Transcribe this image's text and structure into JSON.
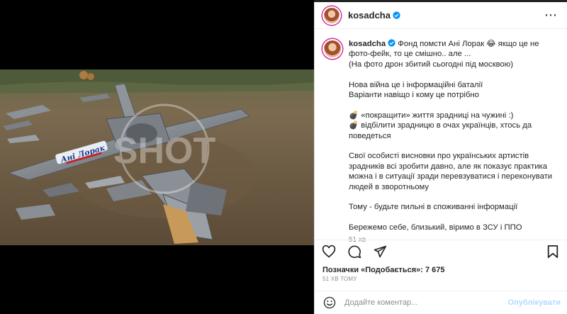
{
  "post": {
    "username": "kosadcha",
    "caption_lines": [
      "Фонд помсти Ані Лорак 😂 якщо це не фото-фейк, то це смішно.. але ...",
      "(На фото дрон збитий сьогодні під москвою)"
    ],
    "paragraph2": [
      "Нова війна це і інформаційні баталії",
      "Варіанти навіщо і кому це потрібно"
    ],
    "paragraph3": [
      "💣 «покращити» життя зрадниці на чужині :)",
      "💣 відбілити зрадницю в очах українців, хтось да поведеться"
    ],
    "paragraph4": "Свої особисті висновки про українських артистів зрадників всі зробити давно, але як показує практика можна і в ситуації зради перевзуватися і переконувати людей в зворотньому",
    "paragraph5": "Тому - будьте пильні в споживанні інформації",
    "paragraph6": "Бережемо себе, близький, віримо в ЗСУ і ППО",
    "caption_time": "51 хв",
    "likes": "Позначки «Подобається»: 7 675",
    "posted_ago": "51 ХВ ТОМУ",
    "comment_placeholder": "Додайте коментар...",
    "publish_label": "Опублікувати"
  },
  "photo": {
    "drone_text": "Ані Лорак",
    "watermark": "SHOT"
  },
  "colors": {
    "accent": "#0095f6",
    "publish_disabled": "#b3dbff",
    "text": "#262626",
    "muted": "#8e8e8e"
  },
  "icons": [
    "more-icon",
    "verified-icon",
    "heart-icon",
    "comment-icon",
    "share-icon",
    "bookmark-icon",
    "emoji-icon"
  ]
}
